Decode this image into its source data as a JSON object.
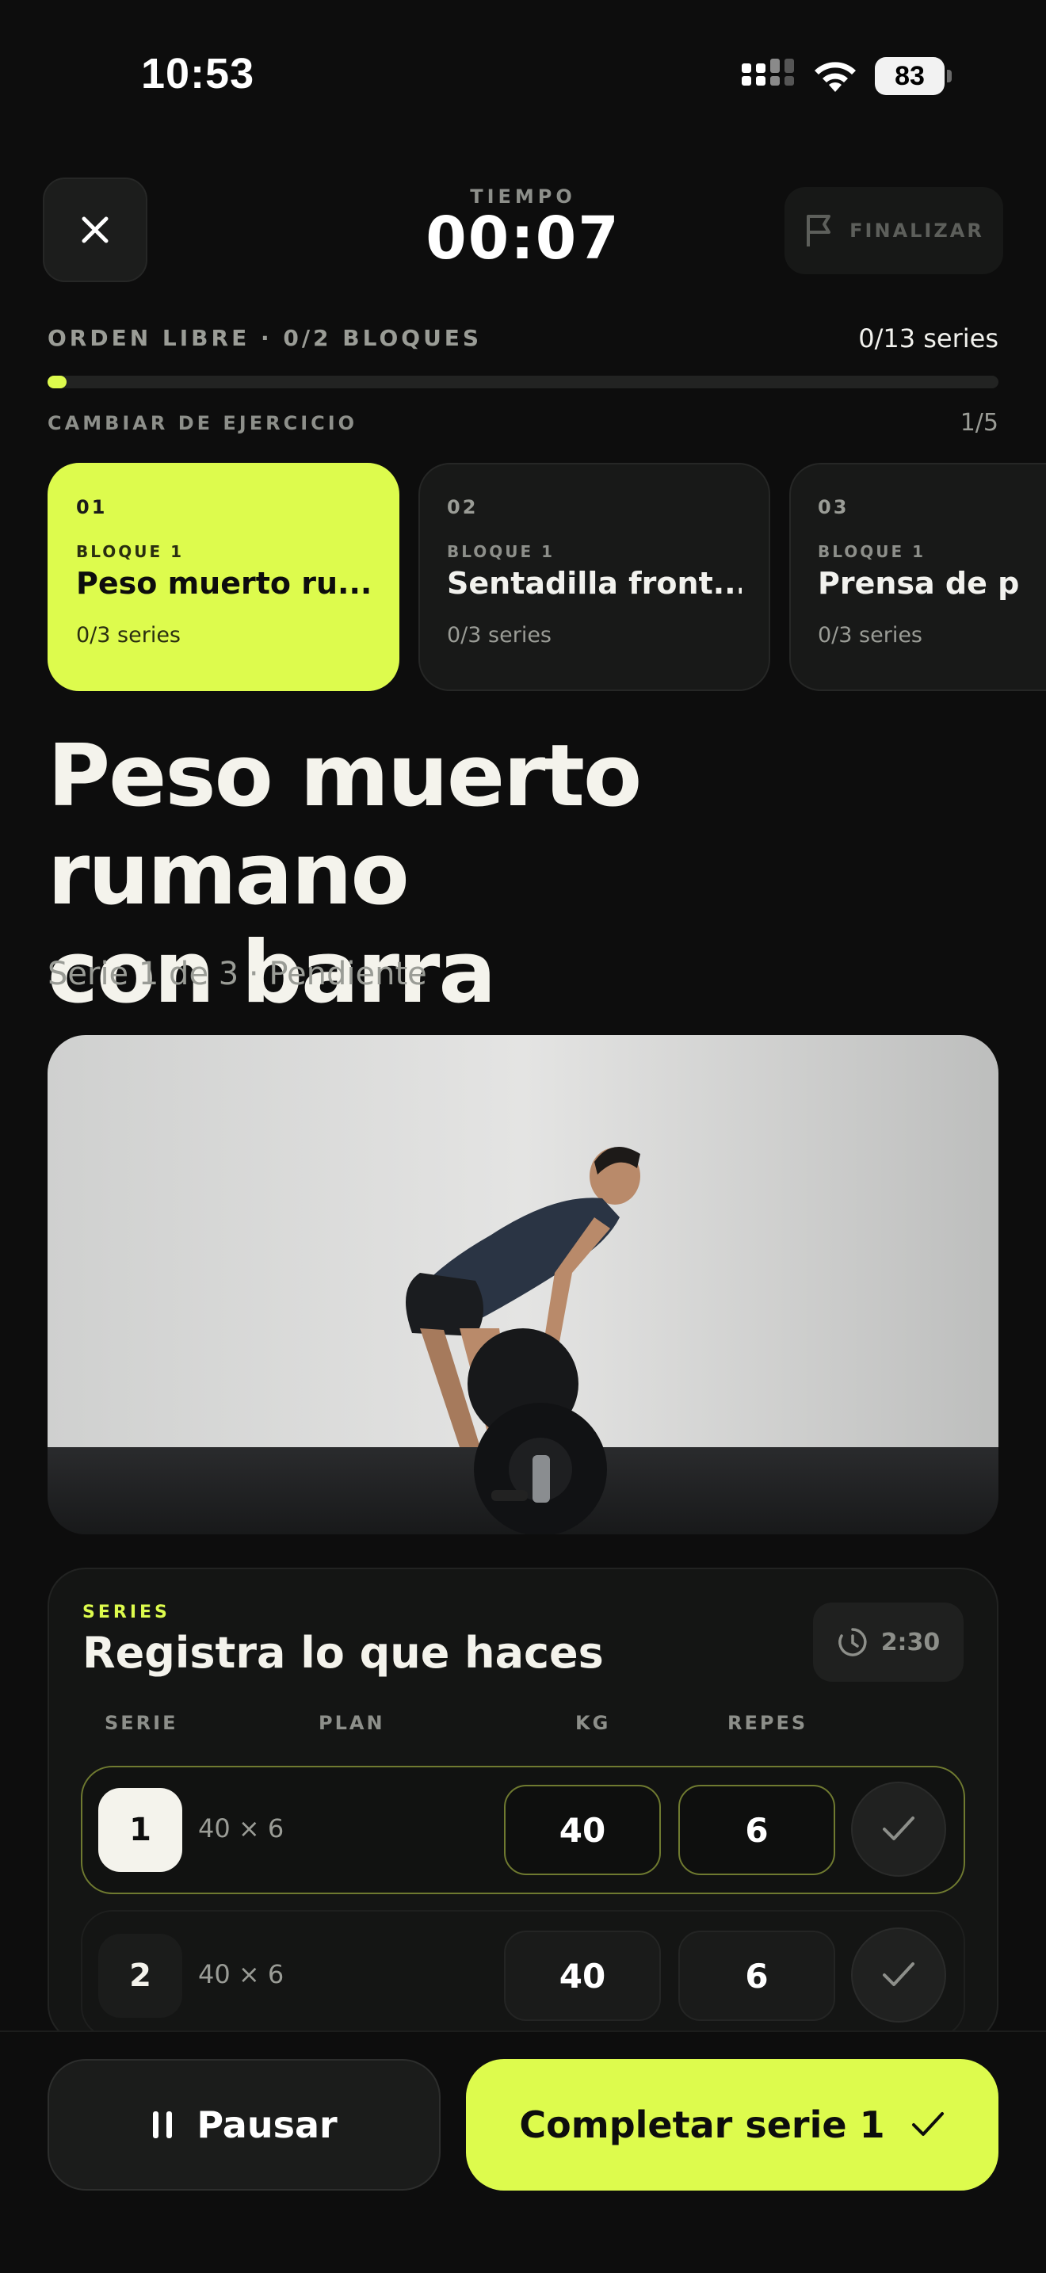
{
  "status": {
    "time": "10:53",
    "battery": "83"
  },
  "header": {
    "timer_label": "TIEMPO",
    "timer_value": "00:07",
    "finish_label": "FINALIZAR"
  },
  "progress": {
    "label": "ORDEN LIBRE · 0/2 BLOQUES",
    "count": "0/13 series",
    "fraction": 0.0
  },
  "exercise_switch": {
    "label": "CAMBIAR DE EJERCICIO",
    "count": "1/5"
  },
  "cards": [
    {
      "num": "01",
      "block": "BLOQUE 1",
      "name": "Peso muerto ru...",
      "sets": "0/3 series",
      "active": true
    },
    {
      "num": "02",
      "block": "BLOQUE 1",
      "name": "Sentadilla front...",
      "sets": "0/3 series",
      "active": false
    },
    {
      "num": "03",
      "block": "BLOQUE 1",
      "name": "Prensa de pierna",
      "sets": "0/3 series",
      "active": false
    }
  ],
  "exercise": {
    "title_line1": "Peso muerto rumano",
    "title_line2": "con barra",
    "subtitle": "Serie 1 de 3 · Pendiente"
  },
  "series_panel": {
    "tag": "SERIES",
    "title": "Registra lo que haces",
    "rest": "2:30",
    "columns": {
      "serie": "SERIE",
      "plan": "PLAN",
      "kg": "KG",
      "reps": "REPES"
    },
    "rows": [
      {
        "num": "1",
        "plan": "40 × 6",
        "kg": "40",
        "reps": "6"
      },
      {
        "num": "2",
        "plan": "40 × 6",
        "kg": "40",
        "reps": "6"
      }
    ]
  },
  "actions": {
    "pause": "Pausar",
    "complete": "Completar serie 1"
  },
  "colors": {
    "accent": "#ddfb4d",
    "background": "#0d0d0d"
  }
}
